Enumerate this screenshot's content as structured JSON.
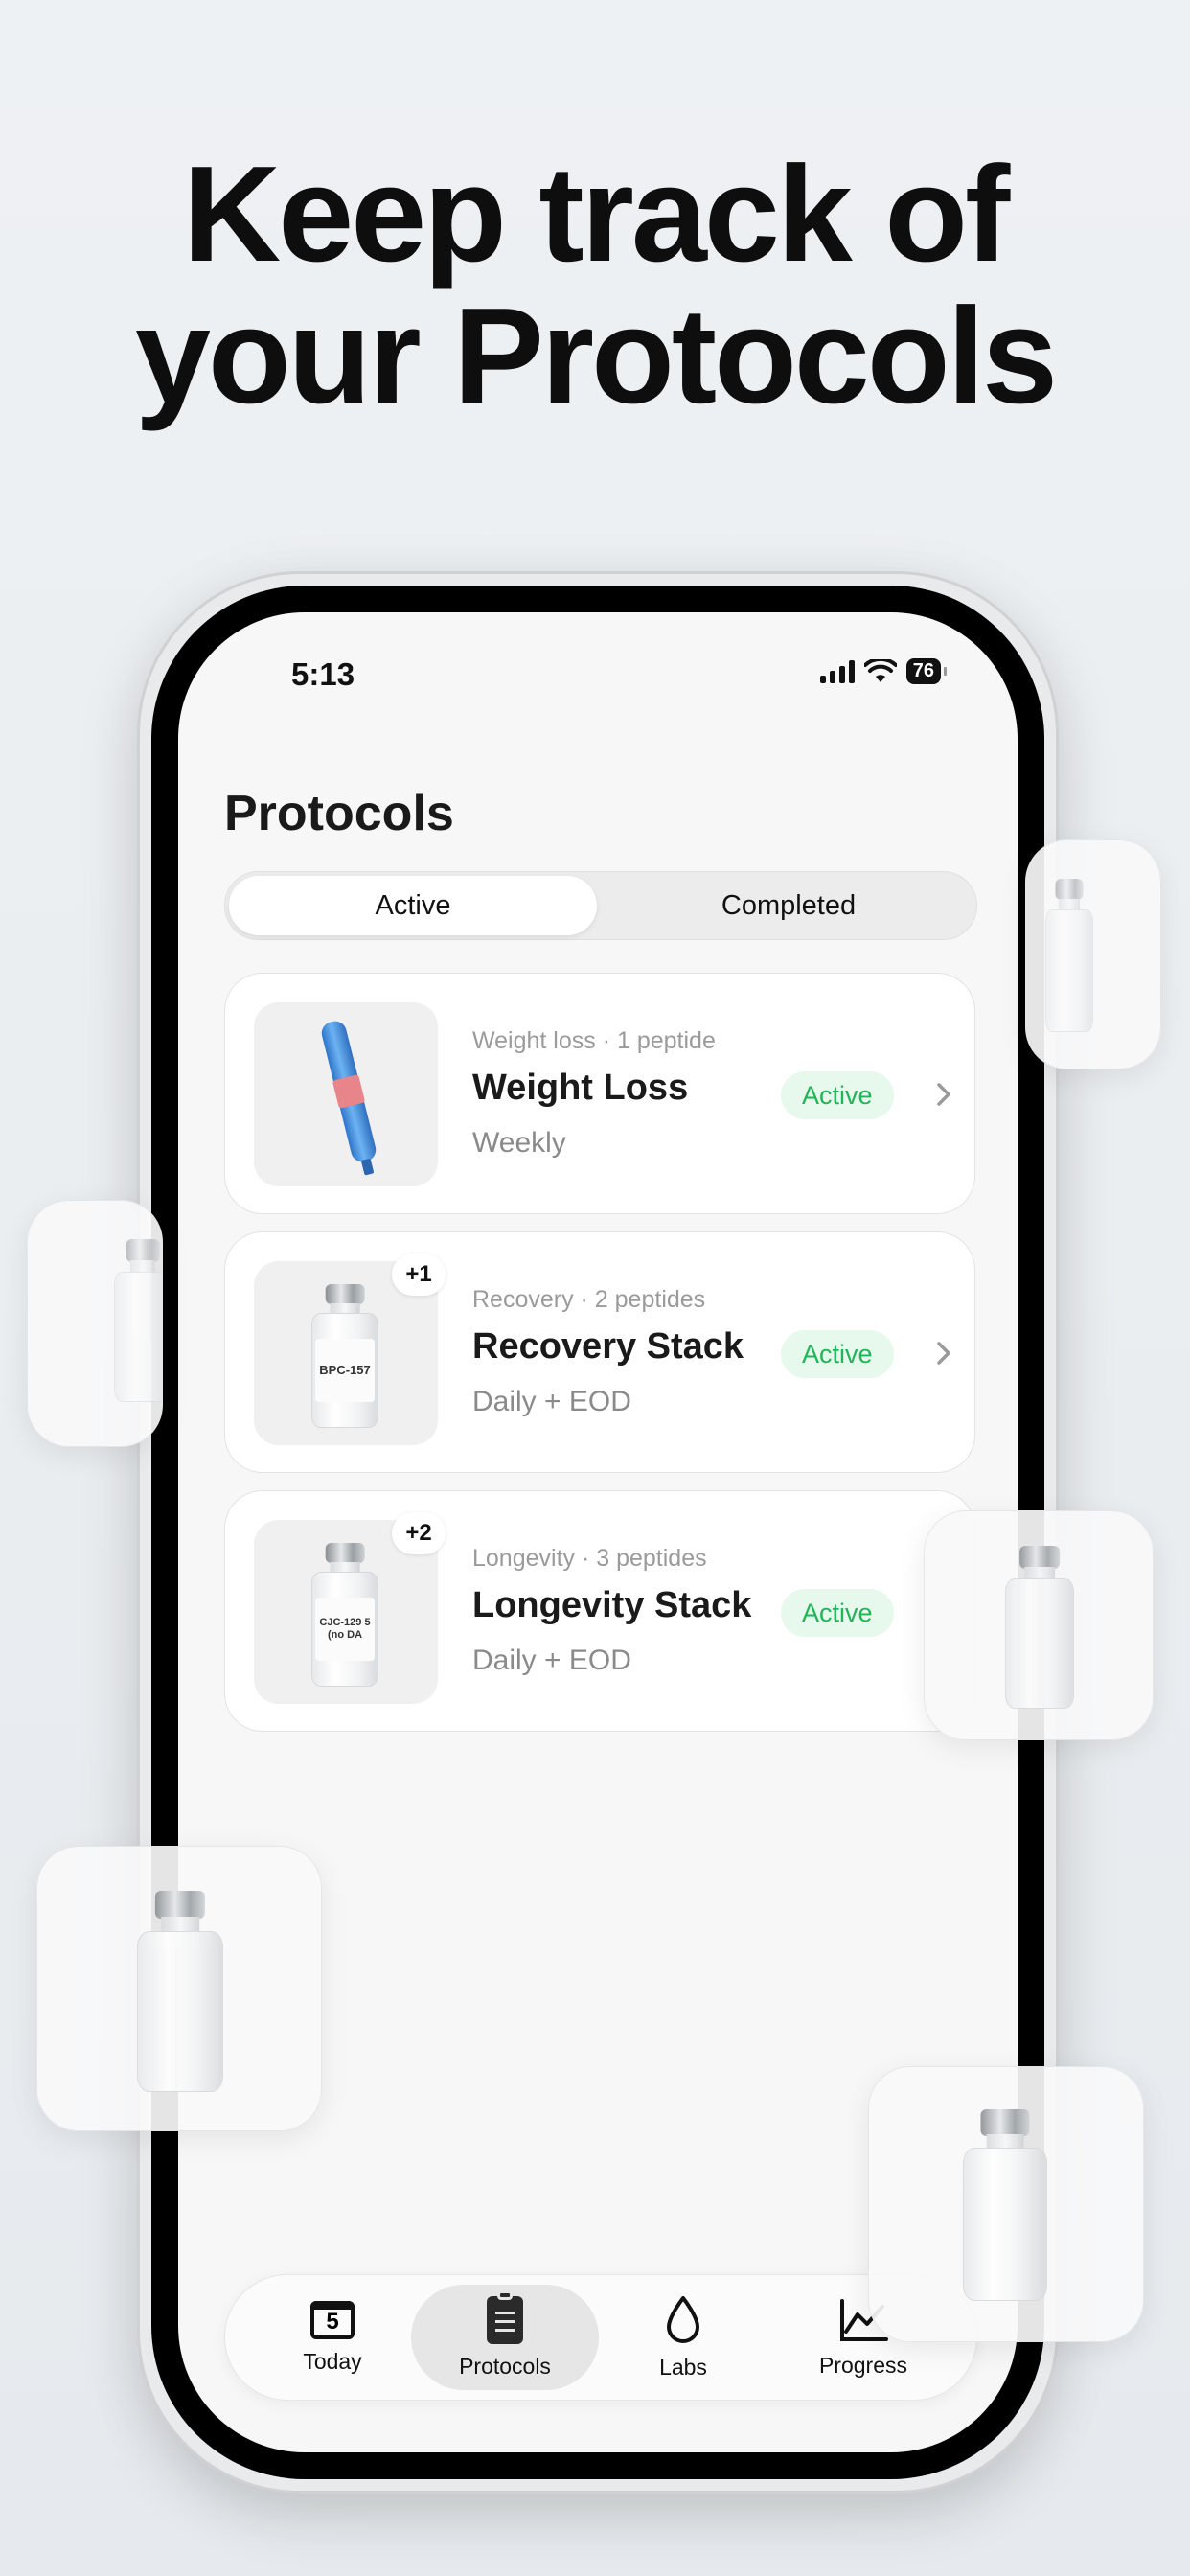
{
  "headline": {
    "line1": "Keep track of",
    "line2": "your Protocols"
  },
  "status_bar": {
    "time": "5:13",
    "battery": "76"
  },
  "screen_title": "Protocols",
  "segments": [
    {
      "label": "Active",
      "selected": true
    },
    {
      "label": "Completed",
      "selected": false
    }
  ],
  "protocols": [
    {
      "meta": "Weight loss · 1 peptide",
      "name": "Weight Loss",
      "schedule": "Weekly",
      "status": "Active",
      "extra": "",
      "thumb": "pen"
    },
    {
      "meta": "Recovery · 2 peptides",
      "name": "Recovery Stack",
      "schedule": "Daily + EOD",
      "status": "Active",
      "extra": "+1",
      "vial_label": "BPC-157"
    },
    {
      "meta": "Longevity · 3 peptides",
      "name": "Longevity Stack",
      "schedule": "Daily + EOD",
      "status": "Active",
      "extra": "+2",
      "vial_label": "CJC-129 5 (no DA"
    }
  ],
  "tabbar": {
    "items": [
      {
        "label": "Today",
        "icon": "calendar-icon",
        "badge": "5"
      },
      {
        "label": "Protocols",
        "icon": "clipboard-icon",
        "selected": true
      },
      {
        "label": "Labs",
        "icon": "drop-icon"
      },
      {
        "label": "Progress",
        "icon": "chart-icon"
      }
    ]
  },
  "colors": {
    "status_active_bg": "#e7f8ec",
    "status_active_text": "#22b458",
    "background": "#e9edf0"
  }
}
